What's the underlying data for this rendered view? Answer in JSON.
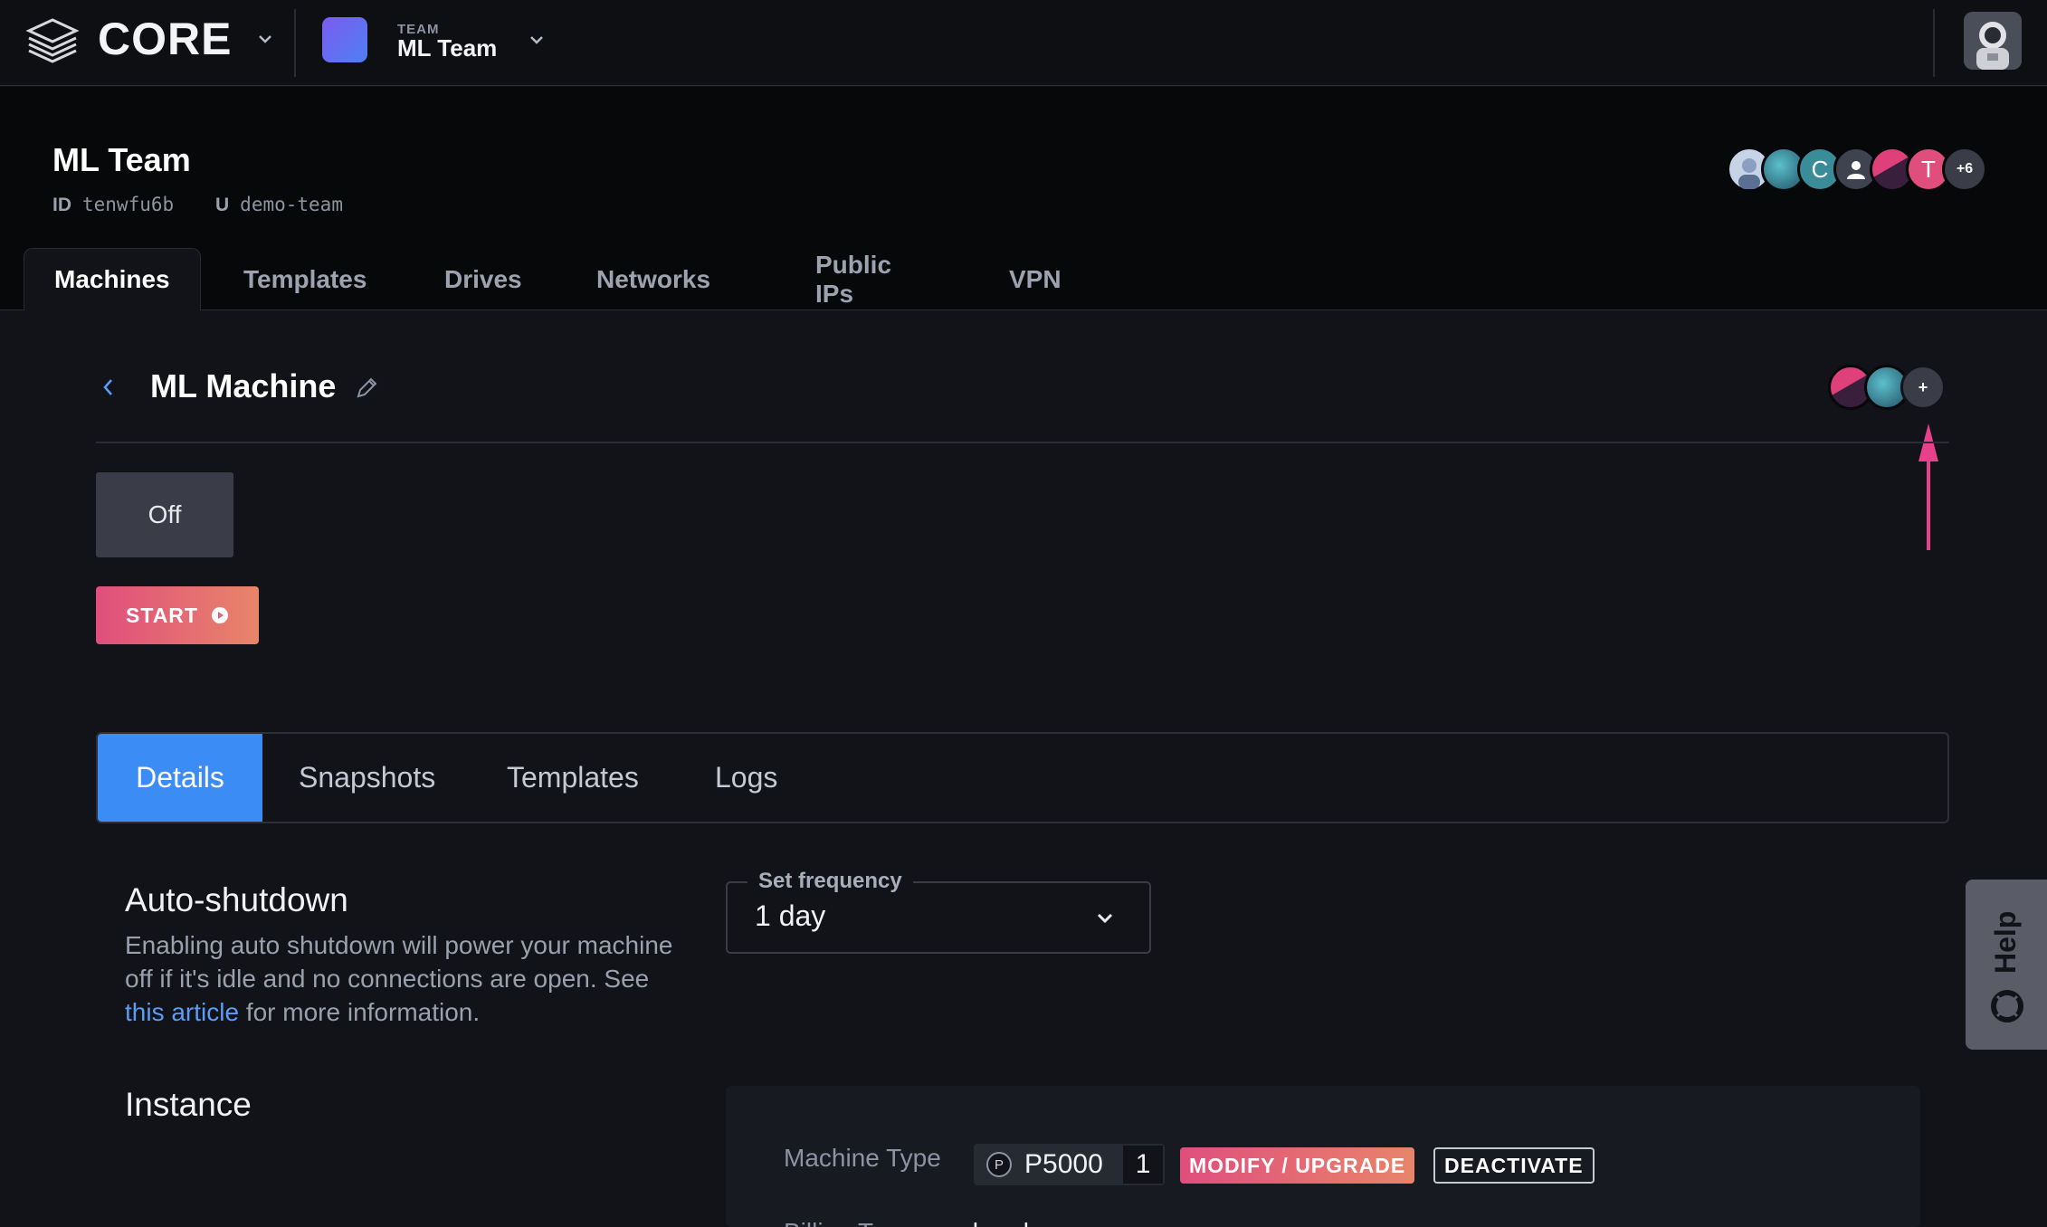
{
  "topbar": {
    "brand": "CORE",
    "team_caption": "TEAM",
    "team_name": "ML Team"
  },
  "header": {
    "title": "ML Team",
    "id_label": "ID",
    "id_value": "tenwfu6b",
    "u_label": "U",
    "u_value": "demo-team",
    "members": [
      {
        "kind": "photo",
        "color": "#c7d3e6"
      },
      {
        "kind": "image",
        "color": "#2f8a9b"
      },
      {
        "kind": "initial",
        "text": "C",
        "color": "#3a8c99"
      },
      {
        "kind": "person-icon",
        "color": "#3f4350"
      },
      {
        "kind": "image",
        "color": "#c23a66"
      },
      {
        "kind": "initial",
        "text": "T",
        "color": "#e04e7d"
      },
      {
        "kind": "more",
        "text": "+6",
        "color": "#3a3d48"
      }
    ]
  },
  "tabs": [
    "Machines",
    "Templates",
    "Drives",
    "Networks",
    "Public IPs",
    "VPN"
  ],
  "active_tab": "Machines",
  "machine": {
    "title": "ML Machine",
    "status": "Off",
    "start_label": "START",
    "add_member_label": "+"
  },
  "subtabs": [
    "Details",
    "Snapshots",
    "Templates",
    "Logs"
  ],
  "active_subtab": "Details",
  "auto_shutdown": {
    "title": "Auto-shutdown",
    "desc_before": "Enabling auto shutdown will power your machine off if it's idle and no connections are open. See ",
    "link": "this article",
    "desc_after": " for more information.",
    "frequency_label": "Set frequency",
    "frequency_value": "1 day"
  },
  "instance": {
    "title": "Instance",
    "machine_type_label": "Machine Type",
    "gpu_icon_letter": "P",
    "gpu": "P5000",
    "qty": "1",
    "modify_label": "MODIFY / UPGRADE",
    "deactivate_label": "DEACTIVATE",
    "cut_label": "Billing Type",
    "cut_value": "hourly"
  },
  "help_label": "Help",
  "colors": {
    "accent_blue": "#3b8cf5",
    "gradient_start": "#e04e7d",
    "gradient_end": "#e8856a",
    "annotation_arrow": "#e8408a"
  }
}
